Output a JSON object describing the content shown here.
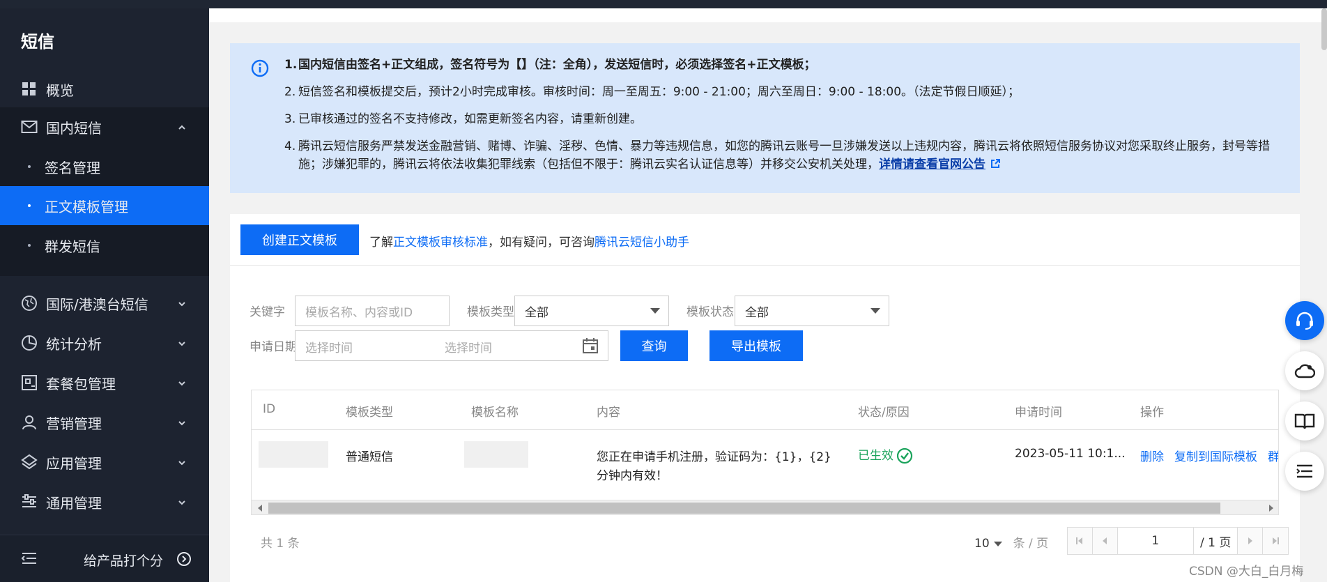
{
  "sidebar": {
    "title": "短信",
    "overview": "概览",
    "domestic": "国内短信",
    "sub_items": [
      "签名管理",
      "正文模板管理",
      "群发短信"
    ],
    "active_sub": "正文模板管理",
    "items": [
      "国际/港澳台短信",
      "统计分析",
      "套餐包管理",
      "营销管理",
      "应用管理",
      "通用管理"
    ],
    "rate_label": "给产品打个分"
  },
  "notice": {
    "items": [
      {
        "n": "1.",
        "text": "国内短信由签名+正文组成，签名符号为【】（注：全角），发送短信时，必须选择签名+正文模板；"
      },
      {
        "n": "2.",
        "text": "短信签名和模板提交后，预计2小时完成审核。审核时间：周一至周五：9:00 - 21:00；周六至周日：9:00 - 18:00。（法定节假日顺延）；"
      },
      {
        "n": "3.",
        "text": "已审核通过的签名不支持修改，如需更新签名内容，请重新创建。"
      },
      {
        "n": "4.",
        "text": "腾讯云短信服务严禁发送金融营销、赌博、诈骗、淫秽、色情、暴力等违规信息，如您的腾讯云账号一旦涉嫌发送以上违规内容，腾讯云将依照短信服务协议对您采取终止服务，封号等措施；涉嫌犯罪的，腾讯云将依法收集犯罪线索（包括但不限于：腾讯云实名认证信息等）并移交公安机关处理，",
        "link": "详情请查看官网公告"
      }
    ]
  },
  "toolbar": {
    "create_label": "创建正文模板",
    "hint_prefix": "了解",
    "hint_link1": "正文模板审核标准",
    "hint_mid": "，如有疑问，可咨询",
    "hint_link2": "腾讯云短信小助手"
  },
  "filters": {
    "keyword_label": "关键字",
    "keyword_placeholder": "模板名称、内容或ID",
    "type_label": "模板类型",
    "type_value": "全部",
    "status_label": "模板状态",
    "status_value": "全部",
    "date_label": "申请日期",
    "date_start_placeholder": "选择时间",
    "date_end_placeholder": "选择时间",
    "query_label": "查询",
    "export_label": "导出模板"
  },
  "table": {
    "columns": [
      "ID",
      "模板类型",
      "模板名称",
      "内容",
      "状态/原因",
      "申请时间",
      "操作"
    ],
    "rows": [
      {
        "type": "普通短信",
        "content_line1": "您正在申请手机注册，验证码为：{1}，{2}",
        "content_line2": "分钟内有效！",
        "status": "已生效",
        "time": "2023-05-11 10:1...",
        "actions": [
          "删除",
          "复制到国际模板",
          "群"
        ]
      }
    ]
  },
  "pagination": {
    "total_text": "共 1 条",
    "page_size": "10",
    "page_size_unit": "条 / 页",
    "current_page": "1",
    "total_pages": "/ 1 页"
  },
  "watermark": "CSDN @大白_白月梅",
  "colors": {
    "primary": "#0d6cf5",
    "sidebar": "#1d2330",
    "success": "#1aa35b",
    "notice_bg": "#d8e7fb"
  }
}
